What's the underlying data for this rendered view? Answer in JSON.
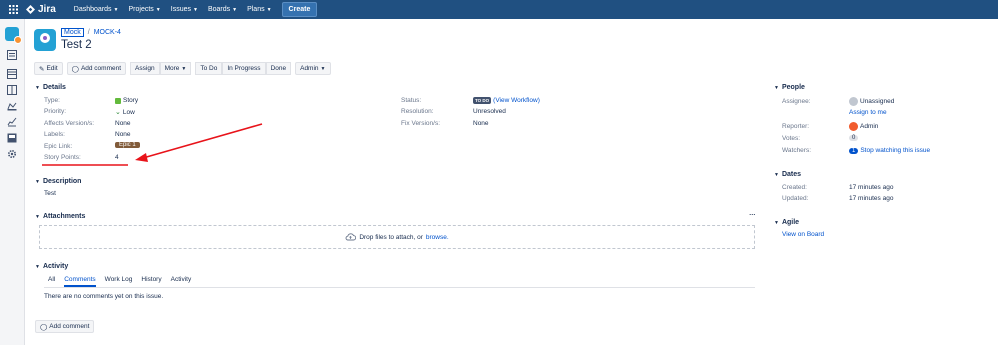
{
  "topnav": {
    "app_name": "Jira",
    "items": [
      "Dashboards",
      "Projects",
      "Issues",
      "Boards",
      "Plans"
    ],
    "create_label": "Create"
  },
  "breadcrumb": {
    "project": "Mock",
    "separator": "/",
    "issue_key": "MOCK-4"
  },
  "issue": {
    "title": "Test 2"
  },
  "toolbar": {
    "edit": "Edit",
    "add_comment": "Add comment",
    "assign": "Assign",
    "more": "More",
    "todo": "To Do",
    "in_progress": "In Progress",
    "done": "Done",
    "admin": "Admin"
  },
  "details": {
    "header": "Details",
    "type_label": "Type:",
    "type_value": "Story",
    "priority_label": "Priority:",
    "priority_value": "Low",
    "affects_label": "Affects Version/s:",
    "affects_value": "None",
    "labels_label": "Labels:",
    "labels_value": "None",
    "epic_label": "Epic Link:",
    "epic_value": "Epic 1",
    "points_label": "Story Points:",
    "points_value": "4",
    "status_label": "Status:",
    "status_value": "TO DO",
    "status_link": "(View Workflow)",
    "resolution_label": "Resolution:",
    "resolution_value": "Unresolved",
    "fix_label": "Fix Version/s:",
    "fix_value": "None"
  },
  "description": {
    "header": "Description",
    "text": "Test"
  },
  "attachments": {
    "header": "Attachments",
    "menu": "…",
    "drop_text": "Drop files to attach, or",
    "browse": "browse."
  },
  "activity": {
    "header": "Activity",
    "tabs": [
      "All",
      "Comments",
      "Work Log",
      "History",
      "Activity"
    ],
    "empty": "There are no comments yet on this issue.",
    "add_comment": "Add comment"
  },
  "people": {
    "header": "People",
    "assignee_label": "Assignee:",
    "assignee_value": "Unassigned",
    "assign_to_me": "Assign to me",
    "reporter_label": "Reporter:",
    "reporter_value": "Admin",
    "votes_label": "Votes:",
    "votes_value": "0",
    "watchers_label": "Watchers:",
    "watchers_count": "1",
    "watchers_link": "Stop watching this issue"
  },
  "dates": {
    "header": "Dates",
    "created_label": "Created:",
    "created_value": "17 minutes ago",
    "updated_label": "Updated:",
    "updated_value": "17 minutes ago"
  },
  "agile": {
    "header": "Agile",
    "link": "View on Board"
  },
  "colors": {
    "nav": "#205081",
    "link": "#0052cc",
    "annotation": "#e8131a"
  }
}
